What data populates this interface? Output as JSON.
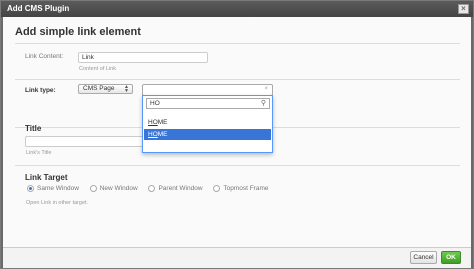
{
  "window": {
    "title": "Add CMS Plugin",
    "close_glyph": "×"
  },
  "form": {
    "heading": "Add simple link element",
    "link_content": {
      "label": "Link Content:",
      "value": "Link",
      "help": "Content of Link"
    },
    "link_type": {
      "label": "Link type:",
      "select_value": "CMS Page",
      "select2": {
        "clear_glyph": "×",
        "search_value": "HO",
        "search_icon": "magnifier-icon",
        "options": [
          {
            "match": "HO",
            "rest": "ME"
          },
          {
            "match": "HO",
            "rest": "ME"
          }
        ]
      }
    },
    "title_section": {
      "heading": "Title",
      "value": "",
      "help": "Link's Title"
    },
    "target_section": {
      "heading": "Link Target",
      "options": [
        "Same Window",
        "New Window",
        "Parent Window",
        "Topmost Frame"
      ],
      "selected": "Same Window",
      "help": "Open Link in other target."
    }
  },
  "footer": {
    "cancel_label": "Cancel",
    "ok_label": "OK"
  },
  "colors": {
    "highlight": "#3875d7",
    "ok_button": "#3f9d26"
  }
}
